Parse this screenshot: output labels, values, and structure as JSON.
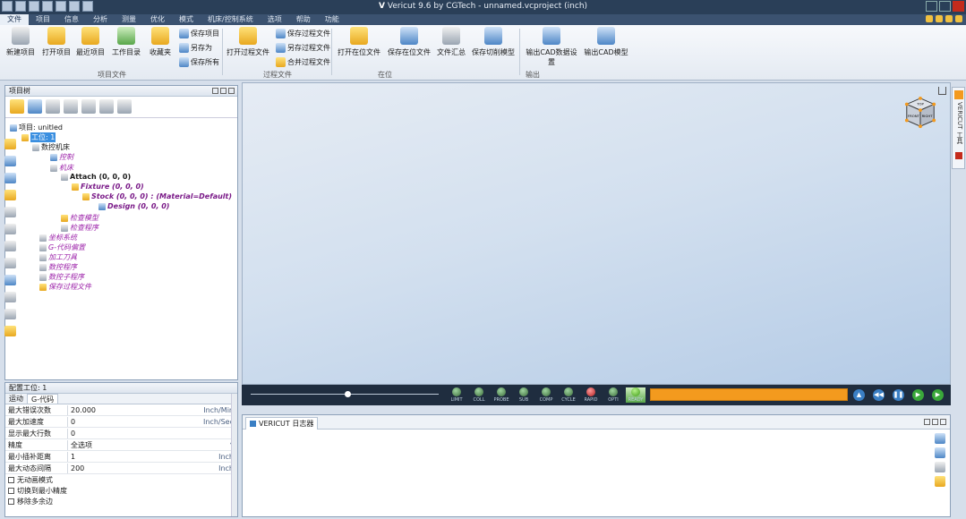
{
  "app": {
    "logo": "V",
    "title": "Vericut 9.6 by CGTech - unnamed.vcproject (inch)"
  },
  "menu": [
    "文件",
    "项目",
    "信息",
    "分析",
    "测量",
    "优化",
    "模式",
    "机床/控制系统",
    "选项",
    "帮助",
    "功能"
  ],
  "ribbon": {
    "new_project": "新建项目",
    "open_project": "打开项目",
    "recent_project": "最近项目",
    "working_dir": "工作目录",
    "favorites": "收藏夹",
    "save_project": "保存项目",
    "save_as": "另存为",
    "save_all": "保存所有",
    "open_process": "打开过程文件",
    "save_process": "保存过程文件",
    "process_save_as": "另存过程文件",
    "merge_process": "合并过程文件",
    "open_inprocess": "打开在位文件",
    "save_inprocess": "保存在位文件",
    "file_summary": "文件汇总",
    "save_cut_model": "保存切削模型",
    "export_settings": "输出CAD数据设置",
    "export_model": "输出CAD模型",
    "groups": {
      "project_file": "项目文件",
      "process_file": "过程文件",
      "inprocess": "在位",
      "export": "输出"
    }
  },
  "project_tree": {
    "title": "项目树",
    "nodes": [
      "项目: unitled",
      "工位: 1",
      "数控机床",
      "控制",
      "机床",
      "Attach (0, 0, 0)",
      "Fixture (0, 0, 0)",
      "Stock (0, 0, 0) : (Material=Default)",
      "Design (0, 0, 0)",
      "检查模型",
      "检查程序",
      "坐标系统",
      "G-代码偏置",
      "加工刀具",
      "数控程序",
      "数控子程序",
      "保存过程文件"
    ]
  },
  "props": {
    "title": "配置工位: 1",
    "tabs": [
      "运动",
      "G-代码"
    ],
    "rows": [
      {
        "label": "最大错误次数",
        "value": "20.000",
        "unit": "Inch/Min"
      },
      {
        "label": "最大加速度",
        "value": "0",
        "unit": "Inch/Sec"
      },
      {
        "label": "显示最大行数",
        "value": "0",
        "unit": ""
      },
      {
        "label": "精度",
        "value": "全选项",
        "unit": "▾"
      },
      {
        "label": "最小插补距离",
        "value": "1",
        "unit": "Inch"
      },
      {
        "label": "最大动态间隔",
        "value": "200",
        "unit": "Inch"
      }
    ],
    "checks": [
      "无动画模式",
      "切换到最小精度",
      "移除多余边"
    ]
  },
  "simbar": {
    "leds": [
      "LIMIT",
      "COLL",
      "PROBE",
      "SUB",
      "COMP",
      "CYCLE",
      "RAPID",
      "OPTI",
      "READY"
    ],
    "slider_fraction": 0.5,
    "buttons": [
      "▲",
      "◀◀",
      "❚❚",
      "▶"
    ]
  },
  "cube": {
    "faces": [
      "TOP",
      "FRONT",
      "RIGHT"
    ]
  },
  "right_strip": "VERICUT 工具",
  "log": {
    "tab": "VERICUT 日志器"
  }
}
